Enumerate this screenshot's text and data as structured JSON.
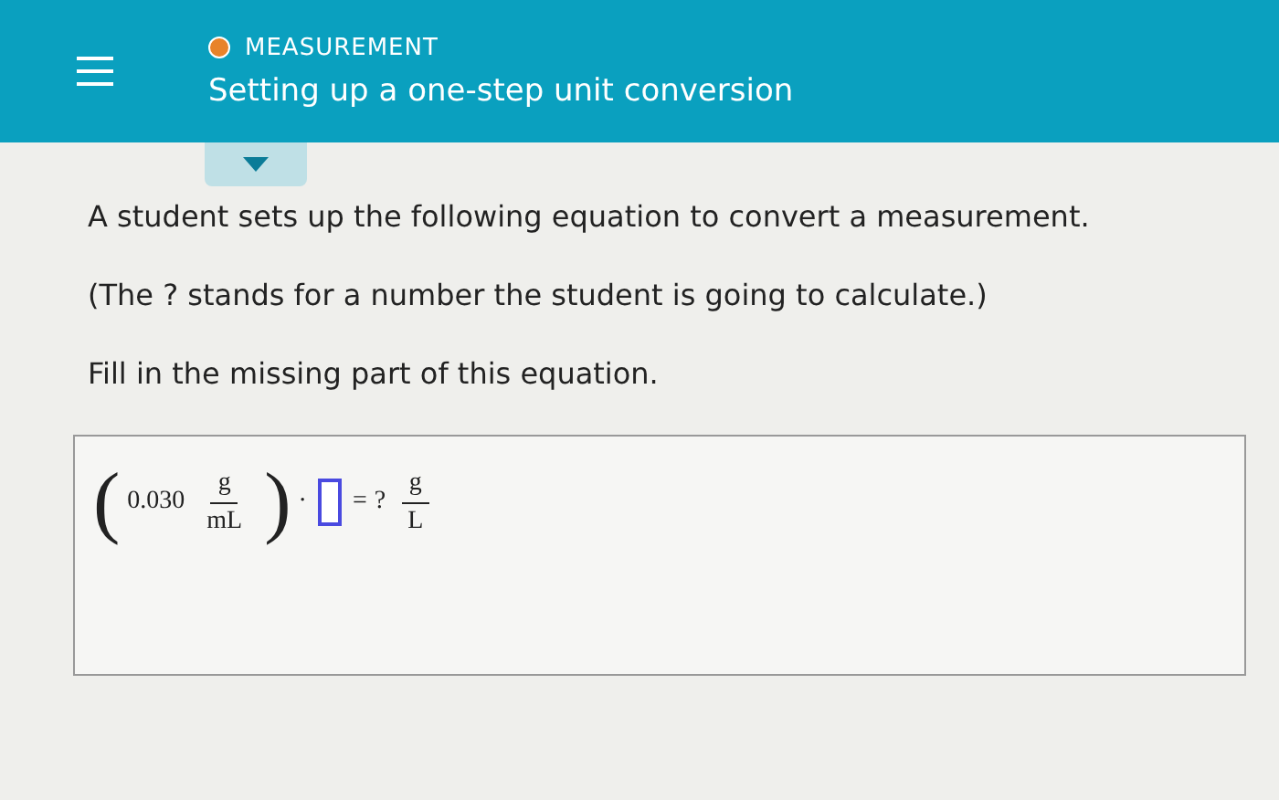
{
  "header": {
    "topic": "MEASUREMENT",
    "title": "Setting up a one-step unit conversion"
  },
  "question": {
    "lines": [
      "A student sets up the following equation to convert a measurement.",
      "(The ? stands for a number the student is going to calculate.)",
      "Fill in the missing part of this equation."
    ]
  },
  "equation": {
    "open_paren": "(",
    "value": "0.030",
    "unit_numerator": "g",
    "unit_denominator": "mL",
    "close_paren": ")",
    "dot": "·",
    "equals": "=",
    "unknown": "?",
    "result_numerator": "g",
    "result_denominator": "L"
  }
}
